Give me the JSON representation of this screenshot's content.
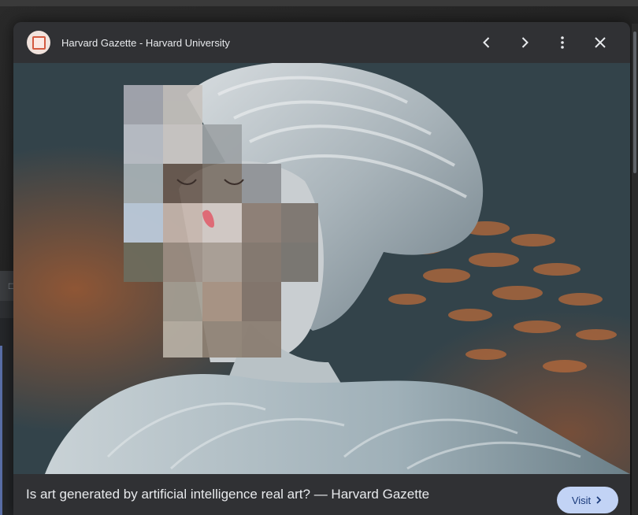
{
  "viewer": {
    "site_name": "Harvard Gazette - Harvard University",
    "favicon_icon": "site-favicon-icon",
    "buttons": {
      "back_icon": "chevron-left-icon",
      "forward_icon": "chevron-right-icon",
      "more_icon": "more-vert-icon",
      "close_icon": "close-icon"
    }
  },
  "caption": {
    "title": "Is art generated by artificial intelligence real art? — Harvard Gazette",
    "visit_label": "Visit"
  },
  "lens": {
    "icon": "lens-search-icon"
  },
  "background": {
    "ghost_close": "×",
    "ghost_square": "□"
  },
  "colors": {
    "header_bg": "#303134",
    "visit_bg": "#c2d3f5",
    "favicon_accent": "#d35a40"
  }
}
